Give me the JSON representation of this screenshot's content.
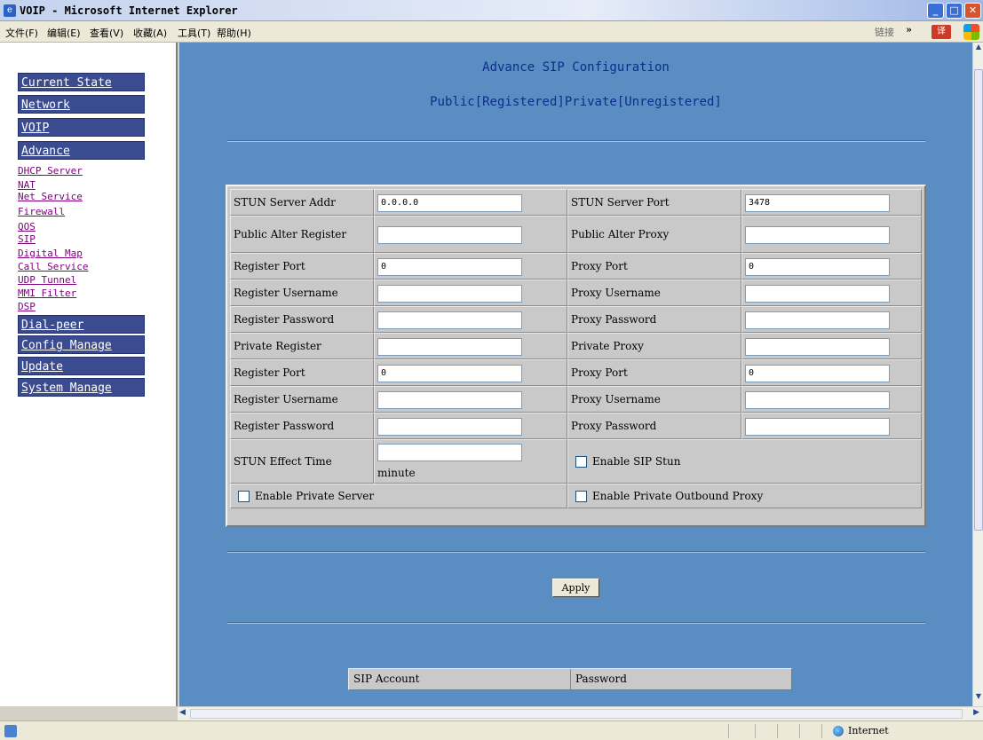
{
  "window": {
    "title": "VOIP - Microsoft Internet Explorer"
  },
  "menubar": {
    "items": [
      "文件(F)",
      "编辑(E)",
      "查看(V)",
      "收藏(A)",
      "工具(T)",
      "帮助(H)"
    ],
    "links_label": "链接",
    "chevron": "»"
  },
  "sidebar": {
    "headers": [
      "Current State",
      "Network",
      "VOIP",
      "Advance"
    ],
    "advance_items": [
      "DHCP Server",
      "NAT",
      "Net Service",
      "Firewall",
      "QOS",
      "SIP",
      "Digital Map",
      "Call Service",
      "UDP Tunnel",
      "MMI Filter",
      "DSP"
    ],
    "bottom_headers": [
      "Dial-peer",
      "Config Manage",
      "Update",
      "System Manage"
    ]
  },
  "main": {
    "title": "Advance SIP Configuration",
    "status": "Public[Registered]Private[Unregistered]",
    "rows": [
      {
        "l1": "STUN Server Addr",
        "v1": "0.0.0.0",
        "l2": "STUN Server Port",
        "v2": "3478"
      },
      {
        "l1": "Public Alter Register",
        "v1": "",
        "l2": "Public Alter Proxy",
        "v2": ""
      },
      {
        "l1": "Register Port",
        "v1": "0",
        "l2": "Proxy Port",
        "v2": "0"
      },
      {
        "l1": "Register Username",
        "v1": "",
        "l2": "Proxy Username",
        "v2": ""
      },
      {
        "l1": "Register Password",
        "v1": "",
        "l2": "Proxy Password",
        "v2": ""
      },
      {
        "l1": "Private Register",
        "v1": "",
        "l2": "Private Proxy",
        "v2": ""
      },
      {
        "l1": "Register Port",
        "v1": "0",
        "l2": "Proxy Port",
        "v2": "0"
      },
      {
        "l1": "Register Username",
        "v1": "",
        "l2": "Proxy Username",
        "v2": ""
      },
      {
        "l1": "Register Password",
        "v1": "",
        "l2": "Proxy Password",
        "v2": ""
      }
    ],
    "stun_effect_time_label": "STUN Effect Time",
    "stun_effect_time_value": "",
    "stun_effect_time_unit": "minute",
    "enable_sip_stun": {
      "label": "Enable SIP Stun",
      "checked": false
    },
    "enable_private_server": {
      "label": "Enable Private Server",
      "checked": false
    },
    "enable_private_outbound_proxy": {
      "label": "Enable Private Outbound Proxy",
      "checked": false
    },
    "apply_label": "Apply",
    "account_table": {
      "headers": [
        "SIP Account",
        "Password"
      ]
    }
  },
  "statusbar": {
    "zone": "Internet"
  },
  "colors": {
    "content_bg": "#5a8ec3",
    "nav_header_bg": "#3b4b8f",
    "title_text": "#0b2f8a",
    "panel_bg": "#c9c9c9"
  }
}
